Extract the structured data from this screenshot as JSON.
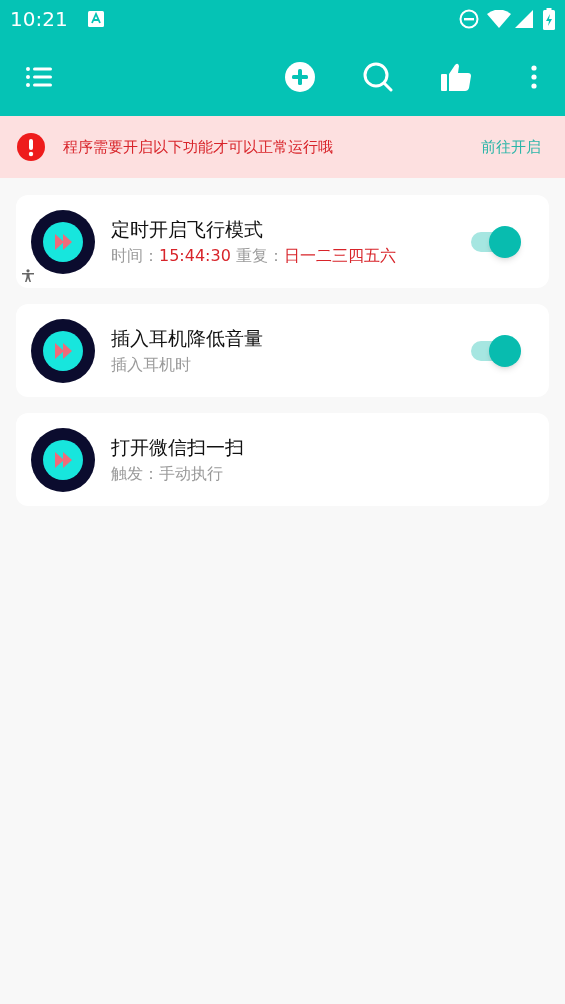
{
  "status_bar": {
    "time": "10:21"
  },
  "notice": {
    "message": "程序需要开启以下功能才可以正常运行哦",
    "action": "前往开启"
  },
  "tasks": [
    {
      "kind": "toggle",
      "title": "定时开启飞行模式",
      "on": true,
      "subtitle": [
        {
          "text": "时间：",
          "highlight": false
        },
        {
          "text": "15:44:30",
          "highlight": true
        },
        {
          "text": " 重复：",
          "highlight": false
        },
        {
          "text": "日一二三四五六",
          "highlight": true
        }
      ]
    },
    {
      "kind": "toggle",
      "title": "插入耳机降低音量",
      "on": true,
      "subtitle": [
        {
          "text": "插入耳机时",
          "highlight": false
        }
      ]
    },
    {
      "kind": "plain",
      "title": "打开微信扫一扫",
      "subtitle": [
        {
          "text": "触发：手动执行",
          "highlight": false
        }
      ]
    }
  ]
}
